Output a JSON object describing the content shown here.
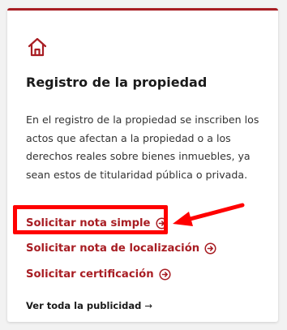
{
  "colors": {
    "accent": "#a81d23",
    "annotation": "#ff0000"
  },
  "card": {
    "icon": "home-icon",
    "title": "Registro de la propiedad",
    "description": "En el registro de la propiedad se inscriben los actos que afectan a la propiedad o a los derechos reales sobre bienes inmuebles, ya sean estos de titularidad pública o privada.",
    "links": [
      {
        "label": "Solicitar nota simple",
        "icon": "arrow-right-circle-icon"
      },
      {
        "label": "Solicitar nota de localización",
        "icon": "arrow-right-circle-icon"
      },
      {
        "label": "Solicitar certificación",
        "icon": "arrow-right-circle-icon"
      }
    ],
    "see_all": {
      "label": "Ver toda la publicidad",
      "arrow": "→"
    }
  }
}
